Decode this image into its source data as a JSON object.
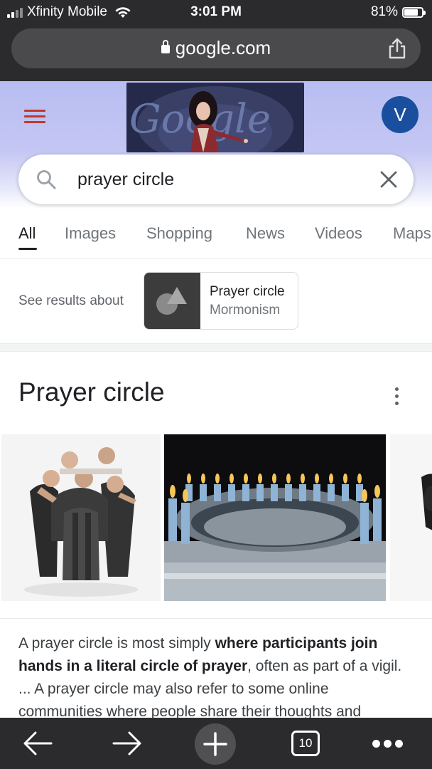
{
  "status_bar": {
    "carrier": "Xfinity Mobile",
    "time": "3:01 PM",
    "battery": "81%",
    "battery_level": 0.81
  },
  "browser": {
    "url": "google.com"
  },
  "header": {
    "avatar_letter": "V",
    "doodle_text": "Google"
  },
  "search": {
    "query": "prayer circle"
  },
  "tabs": [
    {
      "label": "All",
      "active": true
    },
    {
      "label": "Images"
    },
    {
      "label": "Shopping"
    },
    {
      "label": "News"
    },
    {
      "label": "Videos"
    },
    {
      "label": "Maps"
    }
  ],
  "see_results": {
    "label": "See results about",
    "entity_title": "Prayer circle",
    "entity_subtitle": "Mormonism"
  },
  "knowledge_panel": {
    "title": "Prayer circle",
    "description_parts": [
      {
        "text": "A prayer circle is most simply ",
        "bold": false
      },
      {
        "text": "where participants join hands in a literal circle of prayer",
        "bold": true
      },
      {
        "text": ", often as part of a vigil. ... A prayer circle may also refer to some online communities where people share their thoughts and",
        "bold": false
      }
    ]
  },
  "toolbar": {
    "tab_count": "10"
  }
}
